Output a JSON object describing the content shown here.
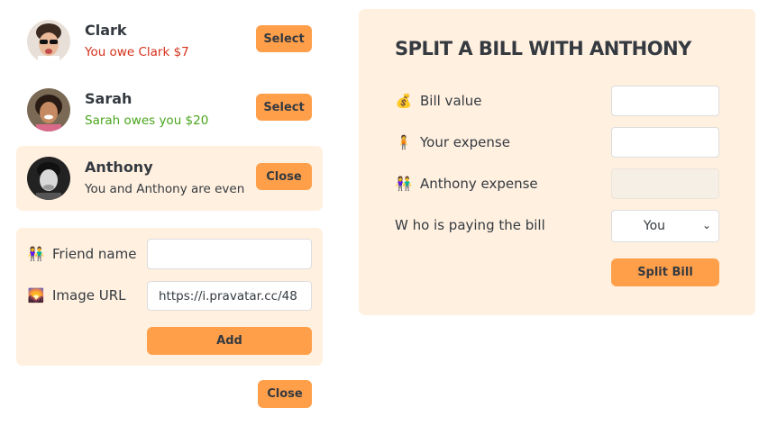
{
  "friends": [
    {
      "name": "Clark",
      "status": "You owe Clark $7",
      "button": "Select"
    },
    {
      "name": "Sarah",
      "status": "Sarah owes you $20",
      "button": "Select"
    },
    {
      "name": "Anthony",
      "status": "You and Anthony are even",
      "button": "Close"
    }
  ],
  "add_form": {
    "name_label": "Friend name",
    "name_emoji": "👫",
    "name_value": "",
    "image_label": "Image URL",
    "image_emoji": "🌄",
    "image_value": "https://i.pravatar.cc/48",
    "add_button": "Add"
  },
  "close_button": "Close",
  "split_form": {
    "title": "SPLIT A BILL WITH ANTHONY",
    "bill_label": "Bill value",
    "bill_emoji": "💰",
    "bill_value": "",
    "expense_label": "Your expense",
    "expense_emoji": "🧍",
    "expense_value": "",
    "friend_expense_label": "Anthony expense",
    "friend_expense_emoji": "👫",
    "friend_expense_value": "",
    "payer_label": "W ho is paying the bill",
    "payer_value": "You",
    "split_button": "Split Bill"
  },
  "colors": {
    "accent": "#ff9f4a",
    "panel": "#fff0e0",
    "owe": "#d6321c",
    "owed": "#49a51d"
  }
}
